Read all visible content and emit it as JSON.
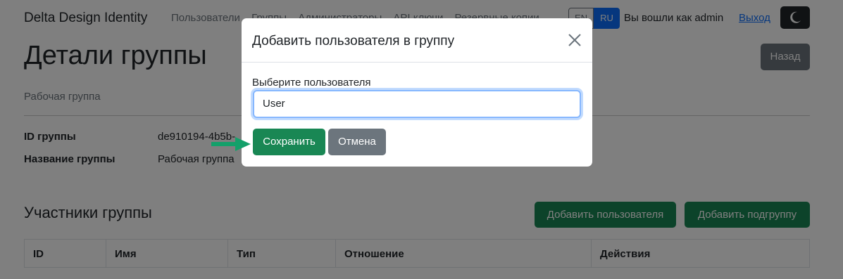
{
  "navbar": {
    "brand": "Delta Design Identity",
    "links": [
      "Пользователи",
      "Группы",
      "Администраторы",
      "API ключи",
      "Резервные копии"
    ],
    "lang_en": "EN",
    "lang_ru": "RU",
    "logged_in_text": "Вы вошли как admin",
    "logout": "Выход",
    "theme_icon": "moon-icon"
  },
  "page": {
    "title": "Детали группы",
    "back": "Назад",
    "subtitle": "Рабочая группа",
    "details": [
      {
        "label": "ID группы",
        "value": "de910194-4b5b-"
      },
      {
        "label": "Название группы",
        "value": "Рабочая группа"
      }
    ],
    "members_title": "Участники группы",
    "add_user": "Добавить пользователя",
    "add_subgroup": "Добавить подгруппу",
    "table_headers": [
      "ID",
      "Имя",
      "Тип",
      "Отношение",
      "Действия"
    ]
  },
  "modal": {
    "title": "Добавить пользователя в группу",
    "close_icon": "close-icon",
    "label": "Выберите пользователя",
    "selected_user": "User",
    "save": "Сохранить",
    "cancel": "Отмена"
  },
  "colors": {
    "primary": "#0d6efd",
    "success": "#198754",
    "secondary": "#6c757d",
    "dark": "#212529"
  }
}
